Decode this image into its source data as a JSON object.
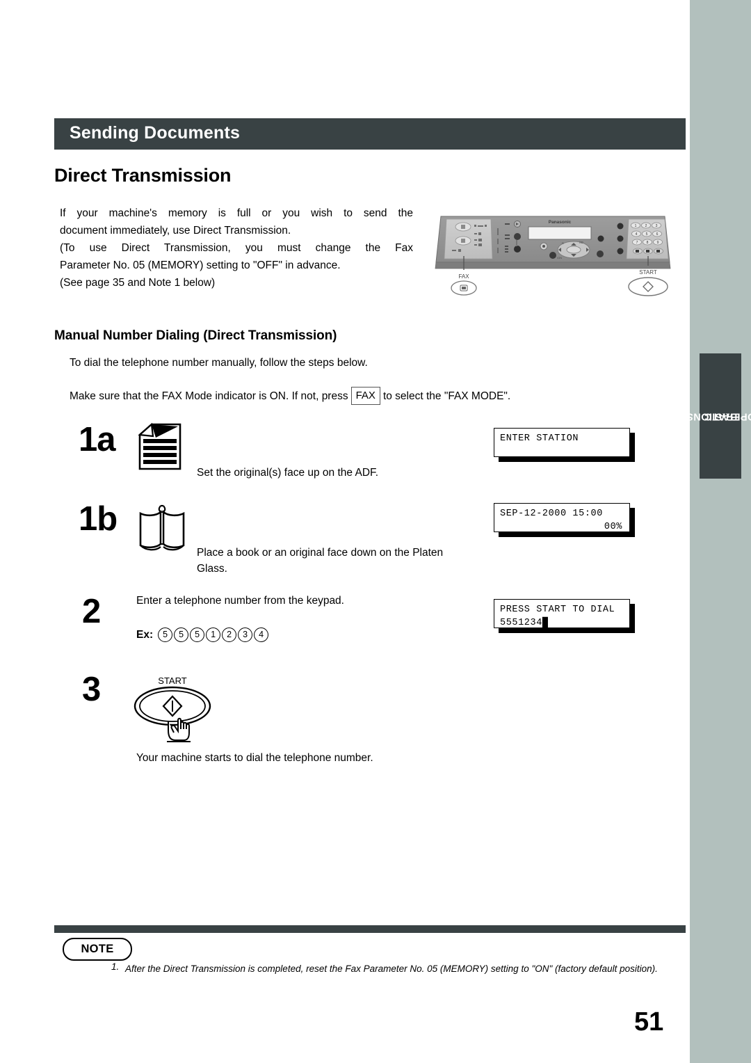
{
  "header": {
    "title": "Sending Documents"
  },
  "section": {
    "heading": "Direct Transmission",
    "intro_line1": "If your machine's memory is full or you wish to send the",
    "intro_line2": "document immediately, use Direct Transmission.",
    "intro_line3": "(To use Direct Transmission, you must change the Fax",
    "intro_line4": "Parameter No. 05 (MEMORY) setting to \"OFF\" in advance.",
    "intro_line5": "(See page 35 and Note 1 below)",
    "subheading": "Manual Number Dialing (Direct Transmission)",
    "lead": "To dial the telephone number manually, follow the steps below.",
    "fax_pre": "Make sure that the FAX Mode indicator is ON.  If not, press",
    "fax_key": "FAX",
    "fax_post": "to select the \"FAX MODE\"."
  },
  "steps": [
    {
      "number": "1a",
      "icon": "document-face-up-icon",
      "text": "Set the original(s) face up on the ADF."
    },
    {
      "number": "1b",
      "icon": "open-book-icon",
      "text": "Place a book or an original face down on the Platen Glass."
    },
    {
      "number": "2",
      "icon": "keypad-digits",
      "text": "Enter a telephone number from the keypad.",
      "example_label": "Ex:",
      "example_digits": [
        "5",
        "5",
        "5",
        "1",
        "2",
        "3",
        "4"
      ]
    },
    {
      "number": "3",
      "icon": "start-button-press-icon",
      "button_label": "START",
      "text": "Your machine starts to dial the telephone number."
    }
  ],
  "displays": [
    {
      "line1": "ENTER STATION",
      "line2": ""
    },
    {
      "line1": "SEP-12-2000 15:00",
      "line2": "00%"
    },
    {
      "line1": "PRESS START TO DIAL",
      "line2": "5551234█"
    }
  ],
  "machine": {
    "brand": "Panasonic",
    "fax_callout": "FAX",
    "start_callout": "START",
    "keypad": [
      "1",
      "2",
      "3",
      "4",
      "5",
      "6",
      "7",
      "8",
      "9"
    ]
  },
  "side_tab": {
    "line1": "BASIC",
    "line2": "OPERATIONS"
  },
  "note": {
    "badge": "NOTE",
    "number": "1.",
    "text": "After the Direct Transmission is completed, reset the Fax Parameter No. 05 (MEMORY) setting to \"ON\" (factory default position)."
  },
  "page_number": "51",
  "colors": {
    "header_bar": "#394244",
    "side_band": "#b2c0bd",
    "panel_gray": "#9a9a9a"
  }
}
